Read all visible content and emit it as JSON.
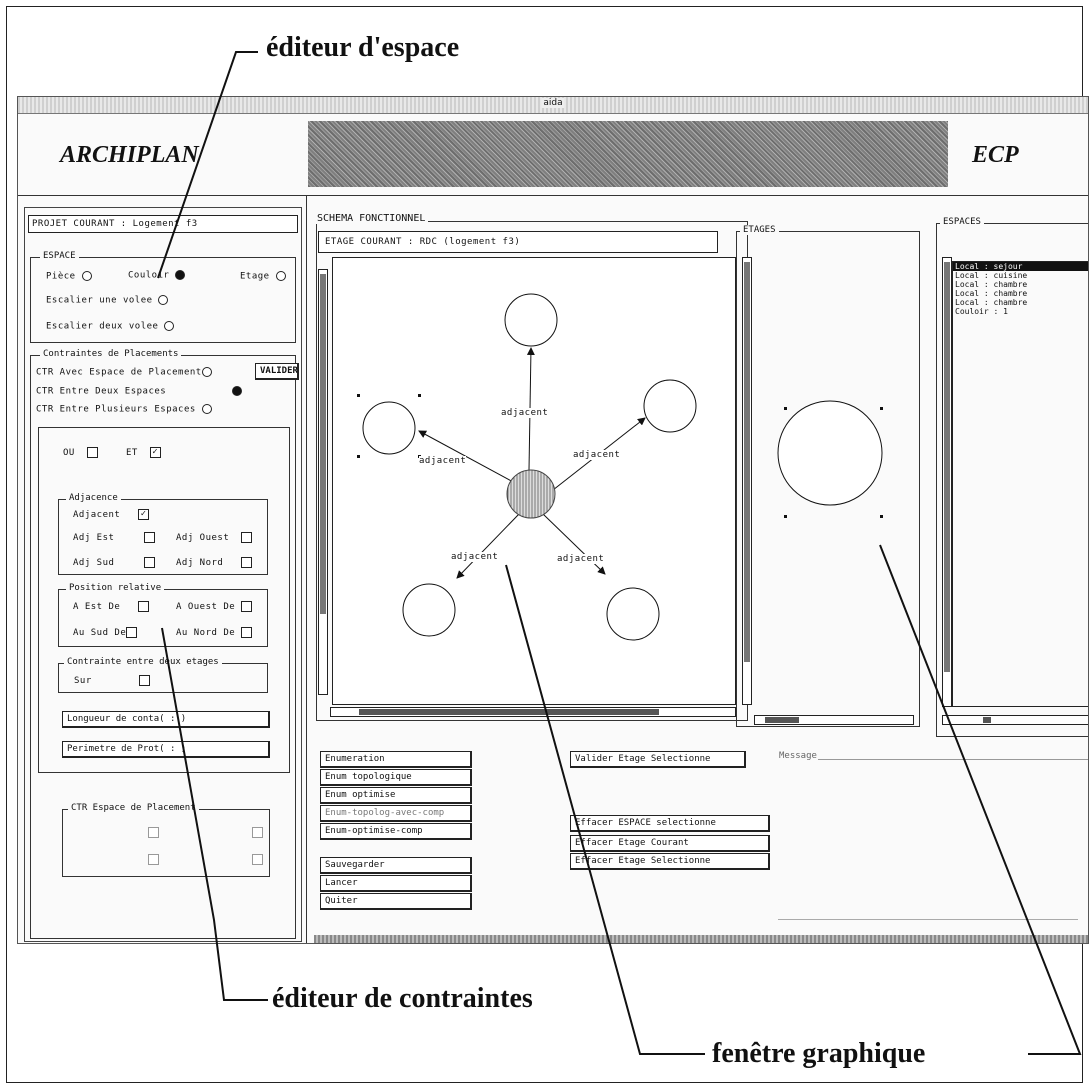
{
  "callouts": {
    "espace": "éditeur d'espace",
    "contraintes": "éditeur de contraintes",
    "fenetre": "fenêtre graphique"
  },
  "window": {
    "title": "aida",
    "app_name": "ARCHIPLAN",
    "org_name": "ECP"
  },
  "left": {
    "projet": "PROJET COURANT  : Logement f3",
    "espace_legend": "ESPACE",
    "radios": {
      "piece": "Pièce",
      "couloir": "Couloir",
      "etage": "Etage",
      "escalier1": "Escalier une volee",
      "escalier2": "Escalier deux volee"
    },
    "contraintes_legend": "Contraintes de Placements",
    "ctr_avec": "CTR Avec Espace de Placement",
    "valider": "VALIDER",
    "ctr_deux": "CTR Entre Deux Espaces",
    "ctr_plusieurs": "CTR Entre Plusieurs Espaces",
    "ou": "OU",
    "et": "ET",
    "adjacence_legend": "Adjacence",
    "adjacent": "Adjacent",
    "adj_est": "Adj Est",
    "adj_ouest": "Adj Ouest",
    "adj_sud": "Adj Sud",
    "adj_nord": "Adj Nord",
    "position_legend": "Position relative",
    "a_est": "A Est De",
    "a_ouest": "A Ouest De",
    "au_sud": "Au Sud De",
    "au_nord": "Au Nord De",
    "etages_legend": "Contrainte entre deux etages",
    "sur": "Sur",
    "longueur": "Longueur de conta(     :     )",
    "perimetre": "Perimetre de Prot(     :     )",
    "ctr_espace_legend": "CTR Espace de Placement"
  },
  "schema": {
    "legend": "SCHEMA FONCTIONNEL",
    "etage_courant": "ETAGE COURANT : RDC (logement f3)",
    "edge_label": "adjacent"
  },
  "etages": {
    "legend": "ETAGES"
  },
  "espaces": {
    "legend": "ESPACES",
    "items": [
      "Local : sejour",
      "Local : cuisine",
      "Local : chambre",
      "Local : chambre",
      "Local : chambre",
      "Couloir : 1"
    ]
  },
  "buttons": {
    "enumeration": "Enumeration",
    "enum_topo": "Enum topologique",
    "enum_opt": "Enum optimise",
    "enum_topo_comp": "Enum-topolog-avec-comp",
    "enum_opt_comp": "Enum-optimise-comp",
    "sauvegarder": "Sauvegarder",
    "lancer": "Lancer",
    "quiter": "Quiter",
    "valider_etage": "Valider Etage Selectionne",
    "effacer_espace": "Effacer ESPACE selectionne",
    "effacer_courant": "Effacer Etage Courant",
    "effacer_selectionne": "Effacer Etage Selectionne"
  },
  "message_legend": "Message"
}
